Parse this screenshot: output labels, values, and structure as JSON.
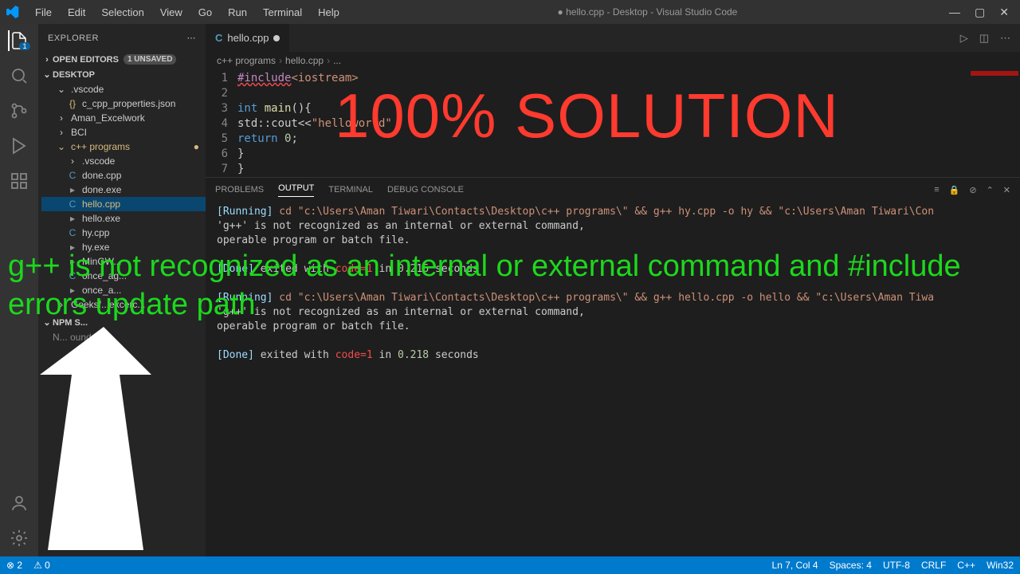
{
  "titlebar": {
    "menus": [
      "File",
      "Edit",
      "Selection",
      "View",
      "Go",
      "Run",
      "Terminal",
      "Help"
    ],
    "title": "● hello.cpp - Desktop - Visual Studio Code"
  },
  "activity": {
    "icons": [
      "files",
      "search",
      "git",
      "debug",
      "extensions"
    ],
    "bottom": [
      "account",
      "settings"
    ]
  },
  "sidebar": {
    "title": "EXPLORER",
    "openEditors": "OPEN EDITORS",
    "unsaved": "1 UNSAVED",
    "root": "DESKTOP",
    "items": [
      {
        "type": "folder",
        "label": ".vscode",
        "indent": 1,
        "open": true
      },
      {
        "type": "file",
        "label": "c_cpp_properties.json",
        "indent": 2,
        "icon": "{}",
        "color": "#d7ba7d"
      },
      {
        "type": "folder",
        "label": "Aman_Excelwork",
        "indent": 1,
        "open": false
      },
      {
        "type": "folder",
        "label": "BCI",
        "indent": 1,
        "open": false
      },
      {
        "type": "folder",
        "label": "c++ programs",
        "indent": 1,
        "open": true,
        "modified": true
      },
      {
        "type": "folder",
        "label": ".vscode",
        "indent": 2,
        "open": false
      },
      {
        "type": "file",
        "label": "done.cpp",
        "indent": 2,
        "icon": "C",
        "color": "#519aba"
      },
      {
        "type": "file",
        "label": "done.exe",
        "indent": 2,
        "icon": "▸",
        "color": "#999"
      },
      {
        "type": "file",
        "label": "hello.cpp",
        "indent": 2,
        "icon": "C",
        "color": "#519aba",
        "selected": true,
        "modified": true
      },
      {
        "type": "file",
        "label": "hello.exe",
        "indent": 2,
        "icon": "▸",
        "color": "#999"
      },
      {
        "type": "file",
        "label": "hy.cpp",
        "indent": 2,
        "icon": "C",
        "color": "#519aba"
      },
      {
        "type": "file",
        "label": "hy.exe",
        "indent": 2,
        "icon": "▸",
        "color": "#999"
      },
      {
        "type": "file",
        "label": "MinGW...",
        "indent": 2,
        "icon": "▸",
        "color": "#999"
      },
      {
        "type": "file",
        "label": "once_ag...",
        "indent": 2,
        "icon": "C",
        "color": "#519aba"
      },
      {
        "type": "file",
        "label": "once_a...",
        "indent": 2,
        "icon": "▸",
        "color": "#999"
      },
      {
        "type": "folder",
        "label": "Geeksf...excerc...",
        "indent": 1,
        "open": false
      }
    ],
    "npm": {
      "header": "NPM S...",
      "body": "N...         ound."
    }
  },
  "tabs": {
    "active": {
      "icon": "C",
      "label": "hello.cpp",
      "modified": true
    }
  },
  "breadcrumbs": [
    "c++ programs",
    "hello.cpp",
    "..."
  ],
  "code": {
    "lines": [
      {
        "n": 1,
        "html": [
          [
            "pp underline",
            "#include"
          ],
          [
            "inc",
            "<iostream>"
          ]
        ]
      },
      {
        "n": 2,
        "html": []
      },
      {
        "n": 3,
        "html": [
          [
            "kw",
            "int"
          ],
          [
            "plain",
            " "
          ],
          [
            "fn",
            "main"
          ],
          [
            "plain",
            "(){"
          ]
        ]
      },
      {
        "n": 4,
        "html": [
          [
            "plain",
            "    std::cout<<"
          ],
          [
            "str",
            "\"helloworld\""
          ]
        ]
      },
      {
        "n": 5,
        "html": [
          [
            "plain",
            "    "
          ],
          [
            "kw",
            "return"
          ],
          [
            "plain",
            " "
          ],
          [
            "num",
            "0"
          ],
          [
            "plain",
            ";"
          ]
        ]
      },
      {
        "n": 6,
        "html": [
          [
            "plain",
            "}"
          ]
        ]
      },
      {
        "n": 7,
        "html": [
          [
            "plain",
            "} "
          ]
        ]
      }
    ]
  },
  "panel": {
    "tabs": [
      "PROBLEMS",
      "OUTPUT",
      "TERMINAL",
      "DEBUG CONSOLE"
    ],
    "activeTab": "OUTPUT",
    "output": [
      {
        "parts": [
          [
            "running",
            "[Running]"
          ],
          [
            "plain",
            " "
          ],
          [
            "cmd",
            "cd \"c:\\Users\\Aman Tiwari\\Contacts\\Desktop\\c++ programs\\\" && g++ hy.cpp -o hy && \"c:\\Users\\Aman Tiwari\\Con"
          ]
        ]
      },
      {
        "parts": [
          [
            "plain",
            "'g++' is not recognized as an internal or external command,"
          ]
        ]
      },
      {
        "parts": [
          [
            "plain",
            "operable program or batch file."
          ]
        ]
      },
      {
        "parts": []
      },
      {
        "parts": [
          [
            "done",
            "[Done]"
          ],
          [
            "plain",
            " exited with "
          ],
          [
            "code",
            "code=1"
          ],
          [
            "plain",
            " in "
          ],
          [
            "num",
            "0.216"
          ],
          [
            "plain",
            " seconds"
          ]
        ]
      },
      {
        "parts": []
      },
      {
        "parts": [
          [
            "running",
            "[Running]"
          ],
          [
            "plain",
            " "
          ],
          [
            "cmd",
            "cd \"c:\\Users\\Aman Tiwari\\Contacts\\Desktop\\c++ programs\\\" && g++ hello.cpp -o hello && \"c:\\Users\\Aman Tiwa"
          ]
        ]
      },
      {
        "parts": [
          [
            "plain",
            "'g++' is not recognized as an internal or external command,"
          ]
        ]
      },
      {
        "parts": [
          [
            "plain",
            "operable program or batch file."
          ]
        ]
      },
      {
        "parts": []
      },
      {
        "parts": [
          [
            "done",
            "[Done]"
          ],
          [
            "plain",
            " exited with "
          ],
          [
            "code",
            "code=1"
          ],
          [
            "plain",
            " in "
          ],
          [
            "num",
            "0.218"
          ],
          [
            "plain",
            " seconds"
          ]
        ]
      }
    ]
  },
  "status": {
    "left": [
      "⊗ 2",
      "⚠ 0"
    ],
    "right": [
      "Ln 7, Col 4",
      "Spaces: 4",
      "UTF-8",
      "CRLF",
      "C++",
      "Win32"
    ]
  },
  "overlay": {
    "title": "100% SOLUTION",
    "sub": "g++ is not recognized as an internal or external command and #include errors update path"
  }
}
